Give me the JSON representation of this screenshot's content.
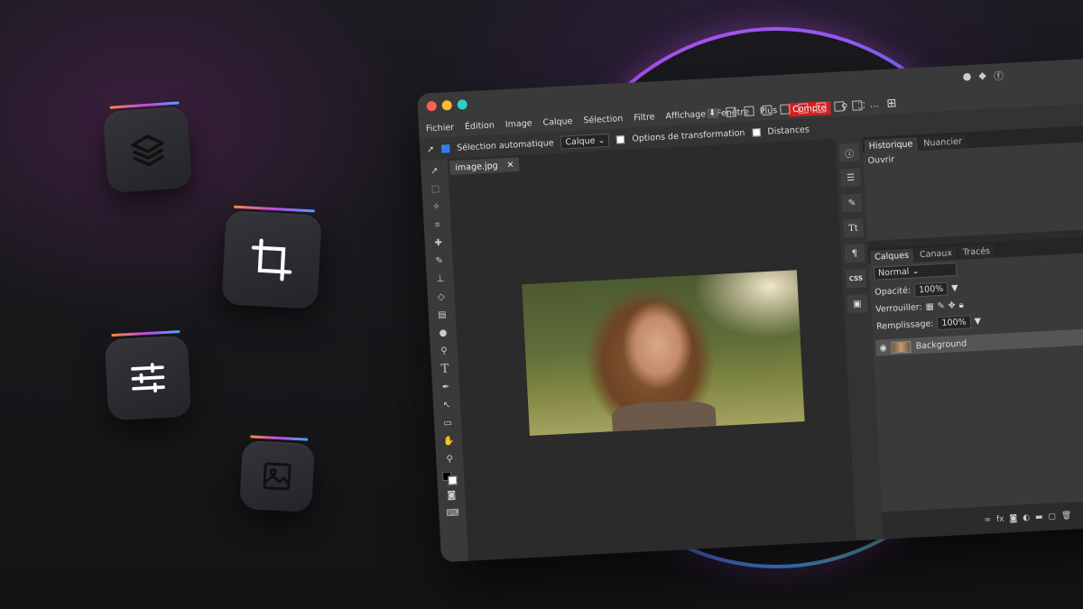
{
  "window": {
    "menu": [
      "Fichier",
      "Édition",
      "Image",
      "Calque",
      "Sélection",
      "Filtre",
      "Affichage",
      "Fenêtre",
      "Plus"
    ],
    "account_label": "Compte"
  },
  "options": {
    "auto_select_label": "Sélection automatique",
    "auto_select_target": "Calque",
    "transform_options_label": "Options de transformation",
    "distances_label": "Distances"
  },
  "document": {
    "tab_name": "image.jpg",
    "close_glyph": "✕"
  },
  "history_panel": {
    "tabs": [
      "Historique",
      "Nuancier"
    ],
    "entries": [
      "Ouvrir"
    ]
  },
  "layers_panel": {
    "tabs": [
      "Calques",
      "Canaux",
      "Tracés"
    ],
    "blend_mode": "Normal",
    "opacity_label": "Opacité:",
    "opacity_value": "100%",
    "lock_label": "Verrouiller:",
    "fill_label": "Remplissage:",
    "fill_value": "100%",
    "layers": [
      {
        "name": "Background",
        "visible": true
      }
    ]
  },
  "right_strip": {
    "css_label": "CSS"
  },
  "colors": {
    "accent_red": "#d42020",
    "close": "#ff5f57",
    "minimize": "#febc2e",
    "maximize": "#2bd1c4"
  },
  "icons": {
    "tiles": [
      "layers-icon",
      "crop-icon",
      "adjustments-icon",
      "image-icon"
    ]
  }
}
